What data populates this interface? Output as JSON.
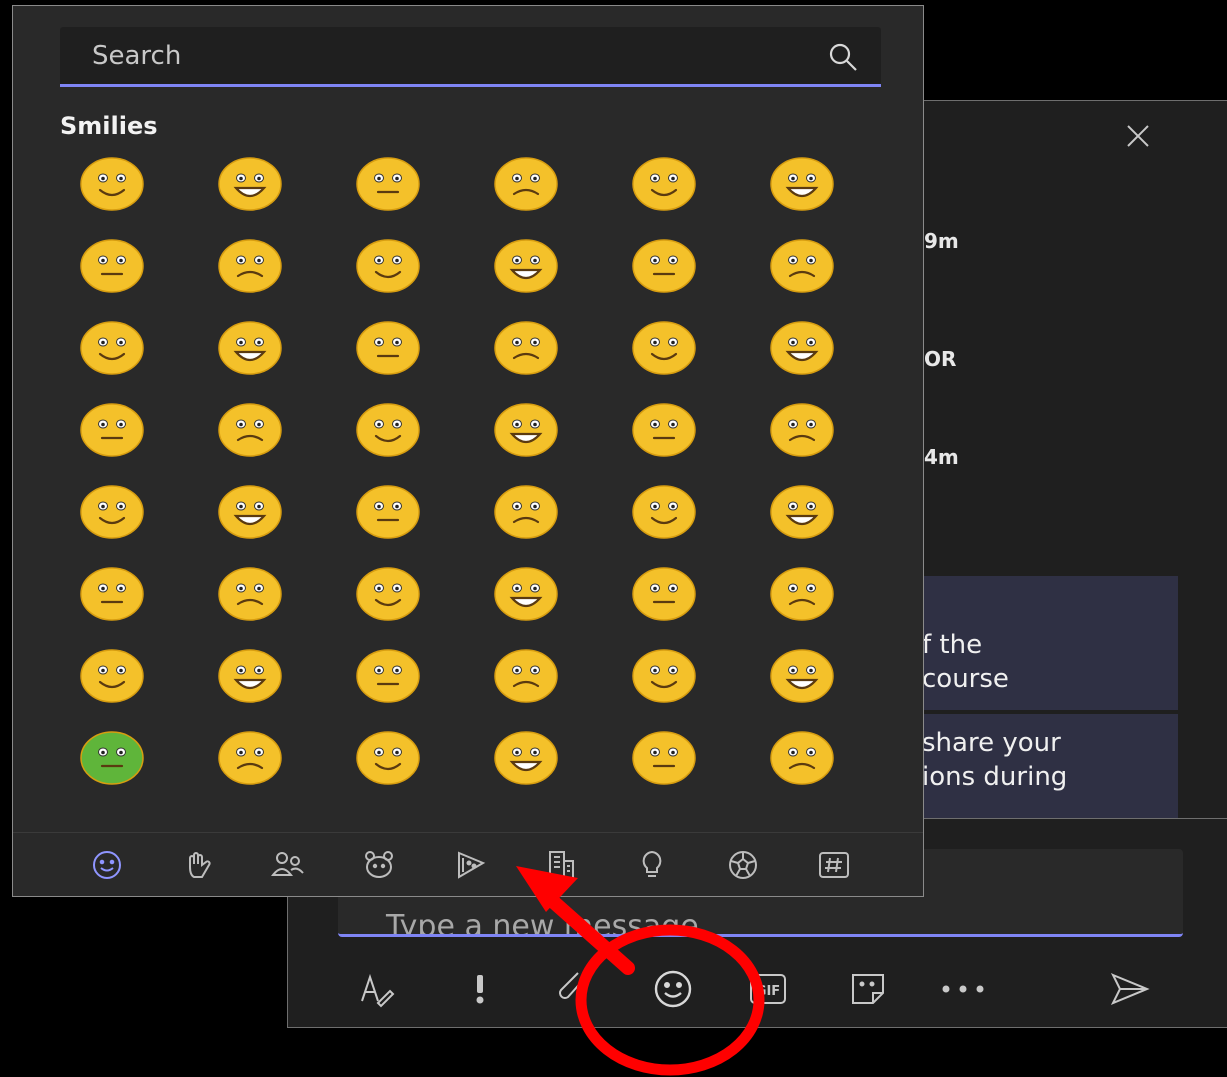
{
  "chat": {
    "fragments": [
      "9m",
      "OR",
      "4m"
    ],
    "card1": [
      "f the",
      "course"
    ],
    "card2": [
      "share your",
      "ions during"
    ],
    "compose_placeholder": "Type a new message"
  },
  "picker": {
    "search_placeholder": "Search",
    "section_title": "Smilies",
    "accent_color": "#7f85f5",
    "emoji_count": 48,
    "categories": [
      "smilies-icon",
      "hand-wave-icon",
      "people-icon",
      "animal-icon",
      "food-icon",
      "building-icon",
      "lightbulb-icon",
      "soccer-ball-icon",
      "symbols-icon"
    ]
  },
  "toolbar": {
    "icons": [
      "format-icon",
      "important-icon",
      "attach-icon",
      "emoji-icon",
      "gif-icon",
      "sticker-icon",
      "more-icon",
      "send-icon"
    ]
  },
  "annotation": {
    "color": "#ff0000"
  }
}
